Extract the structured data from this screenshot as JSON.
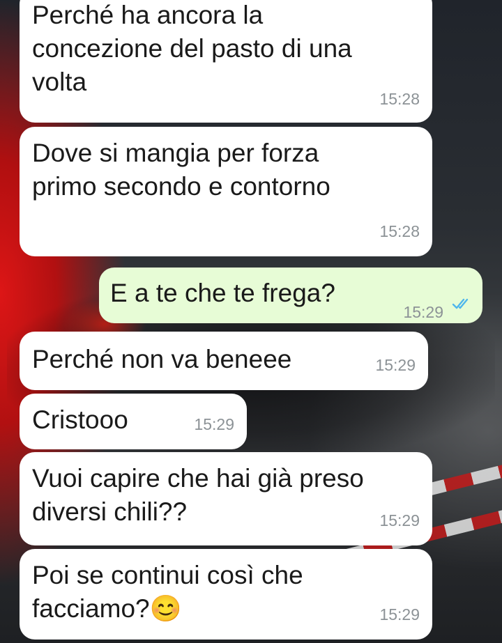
{
  "messages": [
    {
      "direction": "incoming",
      "lines": [
        "Perché ha ancora la",
        "concezione del pasto di una",
        "volta"
      ],
      "time": "15:28"
    },
    {
      "direction": "incoming",
      "lines": [
        "Dove si mangia per forza",
        "primo secondo e contorno"
      ],
      "time": "15:28"
    },
    {
      "direction": "outgoing",
      "lines": [
        "E a te che te frega?"
      ],
      "time": "15:29",
      "status_icon": "double-check-icon",
      "status_color": "#4fb6ec"
    },
    {
      "direction": "incoming",
      "lines": [
        "Perché non va beneee"
      ],
      "time": "15:29"
    },
    {
      "direction": "incoming",
      "lines": [
        "Cristooo"
      ],
      "time": "15:29"
    },
    {
      "direction": "incoming",
      "lines": [
        "Vuoi capire che hai già preso",
        "diversi chili??"
      ],
      "time": "15:29"
    },
    {
      "direction": "incoming",
      "lines": [
        "Poi se continui così che",
        "facciamo?😊"
      ],
      "time": "15:29"
    }
  ],
  "colors": {
    "incoming_bubble": "#ffffff",
    "outgoing_bubble": "#e7fcd6",
    "time_text": "#8c9296",
    "read_ticks": "#4fb6ec"
  }
}
